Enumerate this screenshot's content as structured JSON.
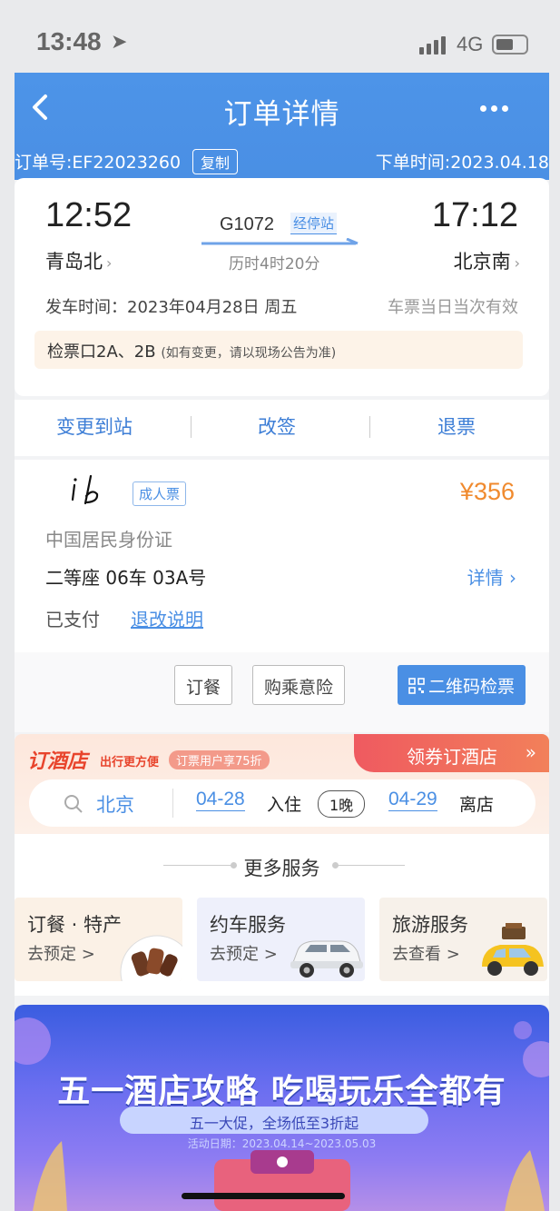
{
  "status_bar": {
    "time": "13:48",
    "network": "4G"
  },
  "header": {
    "title": "订单详情",
    "order_no": "订单号:EF22023260",
    "copy_label": "复制",
    "order_time": "下单时间:2023.04.18"
  },
  "trip": {
    "departure_time": "12:52",
    "arrival_time": "17:12",
    "departure_station": "青岛北",
    "arrival_station": "北京南",
    "train_no": "G1072",
    "stops_label": "经停站",
    "duration": "历时4时20分",
    "departure_date": "发车时间：2023年04月28日 周五",
    "validity_note": "车票当日当次有效",
    "gate": "检票口2A、2B",
    "gate_note": "(如有变更，请以现场公告为准)"
  },
  "actions": {
    "change_station": "变更到站",
    "reschedule": "改签",
    "refund": "退票"
  },
  "passenger": {
    "ticket_type": "成人票",
    "price": "¥356",
    "id_type": "中国居民身份证",
    "seat": "二等座 06车 03A号",
    "detail_label": "详情",
    "pay_status": "已支付",
    "refund_rules": "退改说明",
    "meal_btn": "订餐",
    "insurance_btn": "购乘意险",
    "qr_btn": "二维码检票"
  },
  "hotel": {
    "title": "订酒店",
    "slogan": "出行更方便",
    "promo": "订票用户享75折",
    "coupon": "领券订酒店",
    "city": "北京",
    "checkin_date": "04-28",
    "checkin_label": "入住",
    "nights": "1晚",
    "checkout_date": "04-29",
    "checkout_label": "离店"
  },
  "more_services": {
    "title": "更多服务",
    "items": [
      {
        "title": "订餐 · 特产",
        "sub": "去预定 >"
      },
      {
        "title": "约车服务",
        "sub": "去预定 >"
      },
      {
        "title": "旅游服务",
        "sub": "去查看 >"
      }
    ]
  },
  "promo": {
    "title": "五一酒店攻略 吃喝玩乐全都有",
    "subtitle": "五一大促，全场低至3折起",
    "dates": "活动日期：2023.04.14~2023.05.03"
  }
}
